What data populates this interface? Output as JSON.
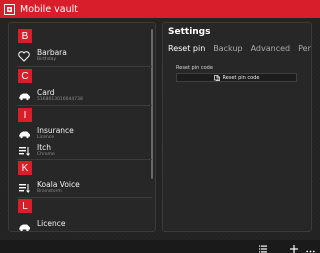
{
  "window": {
    "title": "Mobile vault",
    "accent": "#d81e2a"
  },
  "list": {
    "groups": [
      {
        "letter": "B"
      },
      {
        "letter": "C"
      },
      {
        "letter": "I"
      },
      {
        "letter": "K"
      },
      {
        "letter": "L"
      }
    ],
    "items": [
      {
        "title": "Barbara",
        "subtitle": "Birthday",
        "icon": "heart-icon"
      },
      {
        "title": "Card",
        "subtitle": "5168013016644738",
        "icon": "car-icon"
      },
      {
        "title": "Insurance",
        "subtitle": "Licence",
        "icon": "car-icon"
      },
      {
        "title": "Itch",
        "subtitle": "Chrome",
        "icon": "list-icon"
      },
      {
        "title": "Koala Voice",
        "subtitle": "Brainstorm",
        "icon": "list-icon"
      },
      {
        "title": "Licence",
        "subtitle": "",
        "icon": "car-icon"
      }
    ]
  },
  "settings": {
    "title": "Settings",
    "tabs": [
      "Reset pin",
      "Backup",
      "Advanced",
      "Persona"
    ],
    "active_tab": "Reset pin",
    "reset_pin_label": "Reset pin code",
    "reset_pin_button": "Reset pin code"
  },
  "bottombar": {
    "icons": [
      "list-icon",
      "add-icon",
      "more-icon"
    ]
  }
}
